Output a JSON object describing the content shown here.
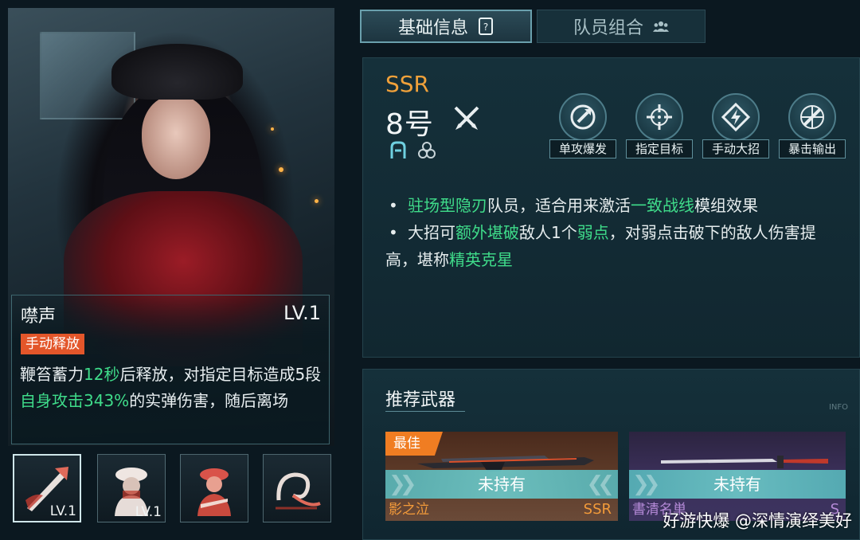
{
  "tabs": [
    {
      "label": "基础信息",
      "icon": "document-icon"
    },
    {
      "label": "队员组合",
      "icon": "team-icon"
    }
  ],
  "character": {
    "rarity": "SSR",
    "name": "8号",
    "class_icon": "crossed-swords-icon",
    "type_icons": [
      "burst-type-icon",
      "element-hex-icon"
    ]
  },
  "traits": [
    {
      "label": "单攻爆发",
      "icon": "single-burst-icon"
    },
    {
      "label": "指定目标",
      "icon": "crosshair-icon"
    },
    {
      "label": "手动大招",
      "icon": "manual-ult-icon"
    },
    {
      "label": "暴击输出",
      "icon": "crit-icon"
    }
  ],
  "description": {
    "line1": {
      "pre": "驻场型隐刃",
      "mid": "队员，适合用来激活",
      "hl": "一致战线",
      "post": "模组效果"
    },
    "line2": {
      "pre": "大招可",
      "hl1": "额外堪破",
      "mid": "敌人1个",
      "hl2": "弱点",
      "post": "，对弱点击破下的敌人伤害提"
    },
    "line3": {
      "pre": "高，堪称",
      "hl": "精英克星"
    }
  },
  "skill": {
    "name": "噤声",
    "level": "LV.1",
    "tag": "手动释放",
    "desc": {
      "p1": "鞭笞蓄力",
      "h1": "12秒",
      "p2": "后释放，对指定目标造成5段",
      "h2": "自身攻击343%",
      "p3": "的实弹伤害，随后离场"
    }
  },
  "skill_icons": [
    {
      "icon": "lance-strike-icon",
      "level": "LV.1",
      "active": true
    },
    {
      "icon": "character-portrait-icon",
      "level": "LV.1",
      "active": false
    },
    {
      "icon": "character-portrait-icon",
      "level": "",
      "active": false
    },
    {
      "icon": "whip-swirl-icon",
      "level": "",
      "active": false
    }
  ],
  "weapons": {
    "title": "推荐武器",
    "info_tag": "INFO",
    "items": [
      {
        "badge": "最佳",
        "status": "未持有",
        "name": "影之泣",
        "rarity": "SSR"
      },
      {
        "badge": "",
        "status": "未持有",
        "name": "書清名単",
        "rarity": "S"
      }
    ]
  },
  "watermark": "好游快爆 @深情演绎美好",
  "colors": {
    "rarity_orange": "#f0a13a",
    "highlight_green": "#3fdc8a",
    "tag_red": "#e3562a",
    "best_badge": "#f07d22",
    "not_owned_bar": "#6cc8c8"
  }
}
